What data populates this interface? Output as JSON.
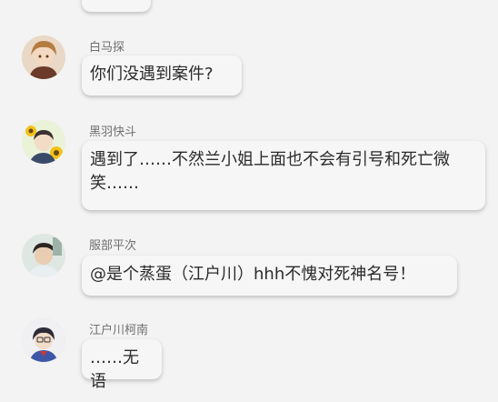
{
  "chat": {
    "messages": [
      {
        "user": "白马探",
        "text": "你们没遇到案件?"
      },
      {
        "user": "黑羽快斗",
        "text": "遇到了……不然兰小姐上面也不会有引号和死亡微笑……"
      },
      {
        "user": "服部平次",
        "text": "@是个蒸蛋（江户川）hhh不愧对死神名号！"
      },
      {
        "user": "江户川柯南",
        "text": "……无语"
      }
    ]
  }
}
